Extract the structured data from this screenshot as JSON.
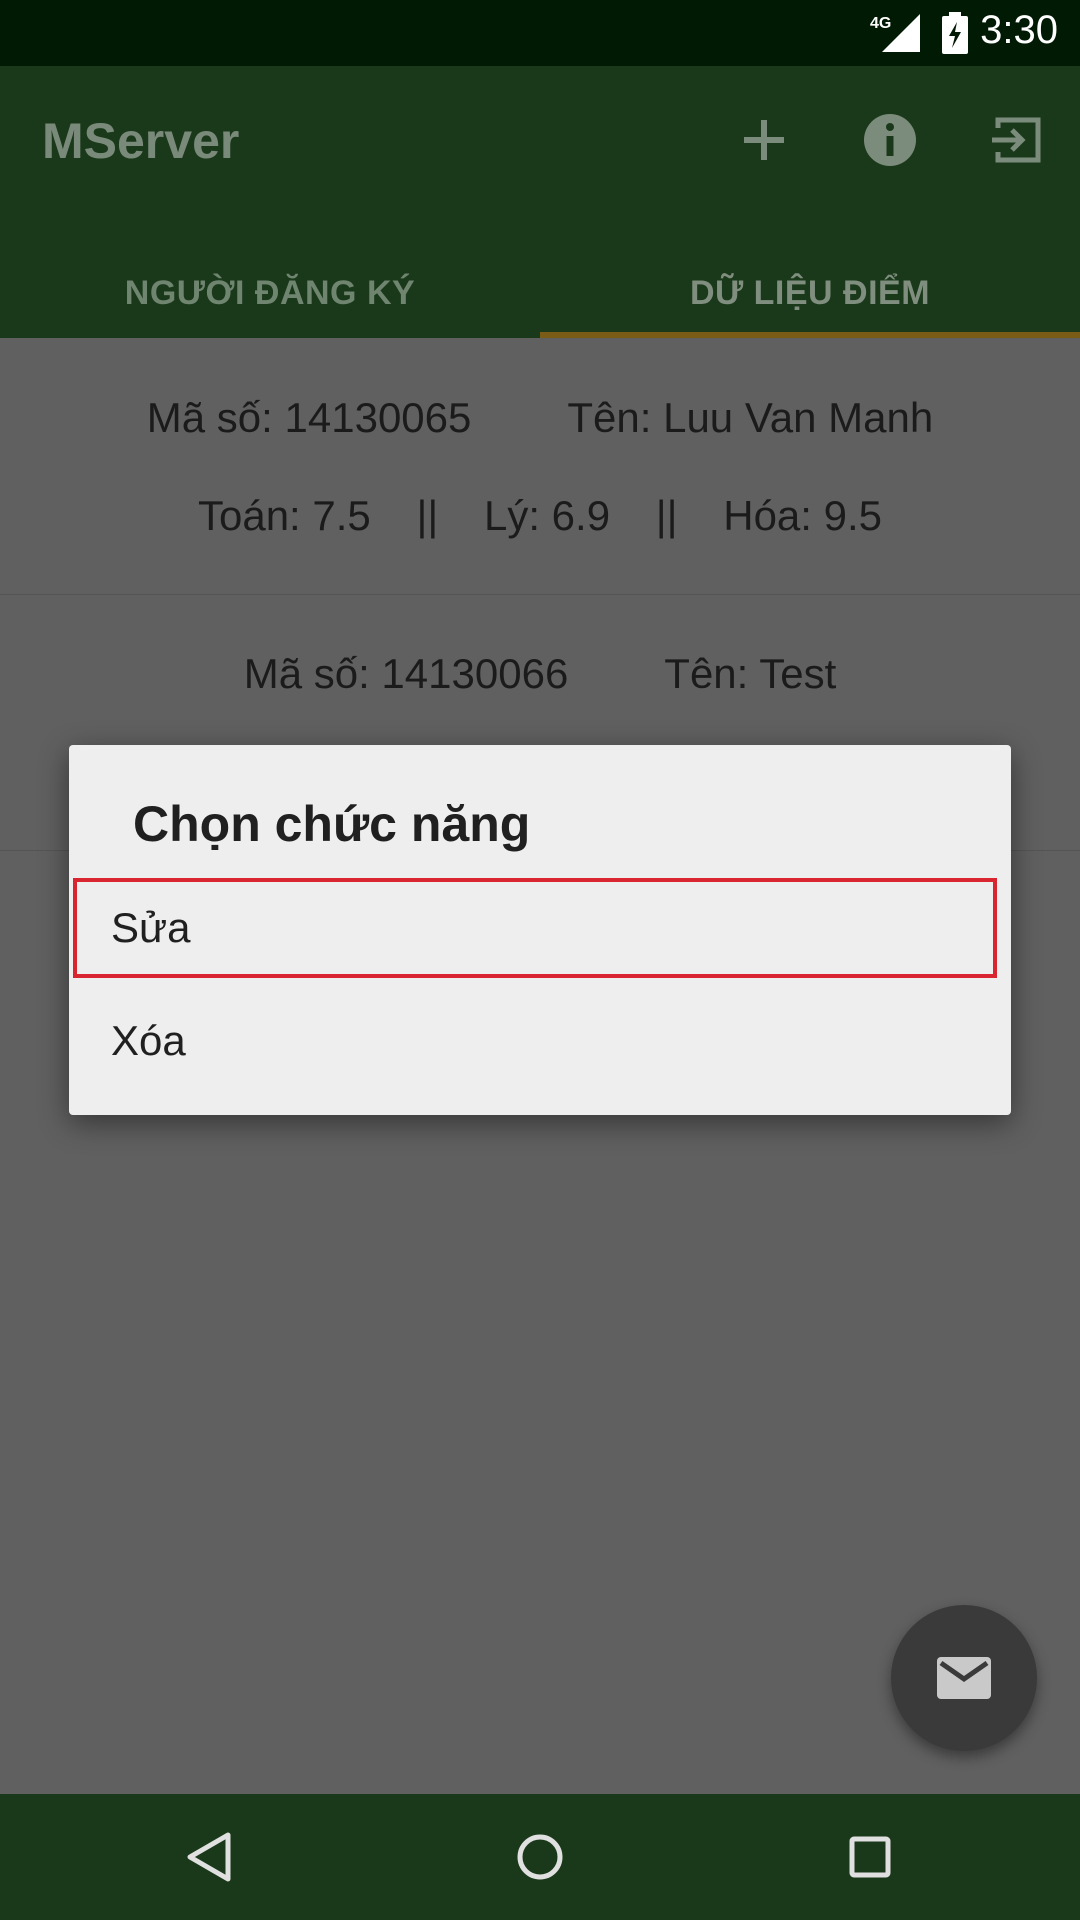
{
  "status_bar": {
    "network": "4G",
    "time": "3:30"
  },
  "app_bar": {
    "title": "MServer",
    "actions": [
      "add-icon",
      "info-icon",
      "logout-icon"
    ]
  },
  "tabs": [
    {
      "label": "NGƯỜI ĐĂNG KÝ",
      "selected": false
    },
    {
      "label": "DỮ LIỆU ĐIỂM",
      "selected": true
    }
  ],
  "records": [
    {
      "id": "Mã số: 14130065",
      "name": "Tên: Luu Van Manh",
      "math": "Toán: 7.5",
      "physics": "Lý: 6.9",
      "chemistry": "Hóa: 9.5"
    },
    {
      "id": "Mã số: 14130066",
      "name": "Tên: Test"
    }
  ],
  "separator": "||",
  "dialog": {
    "title": "Chọn chức năng",
    "options": [
      "Sửa",
      "Xóa"
    ]
  },
  "fab": {
    "icon": "mail-icon"
  },
  "nav": [
    "back-icon",
    "home-icon",
    "recent-apps-icon"
  ],
  "colors": {
    "app_bar": "#1a391a",
    "status_bar": "#001a04",
    "tab_indicator": "#7a5c16",
    "highlight": "#d9252f"
  }
}
